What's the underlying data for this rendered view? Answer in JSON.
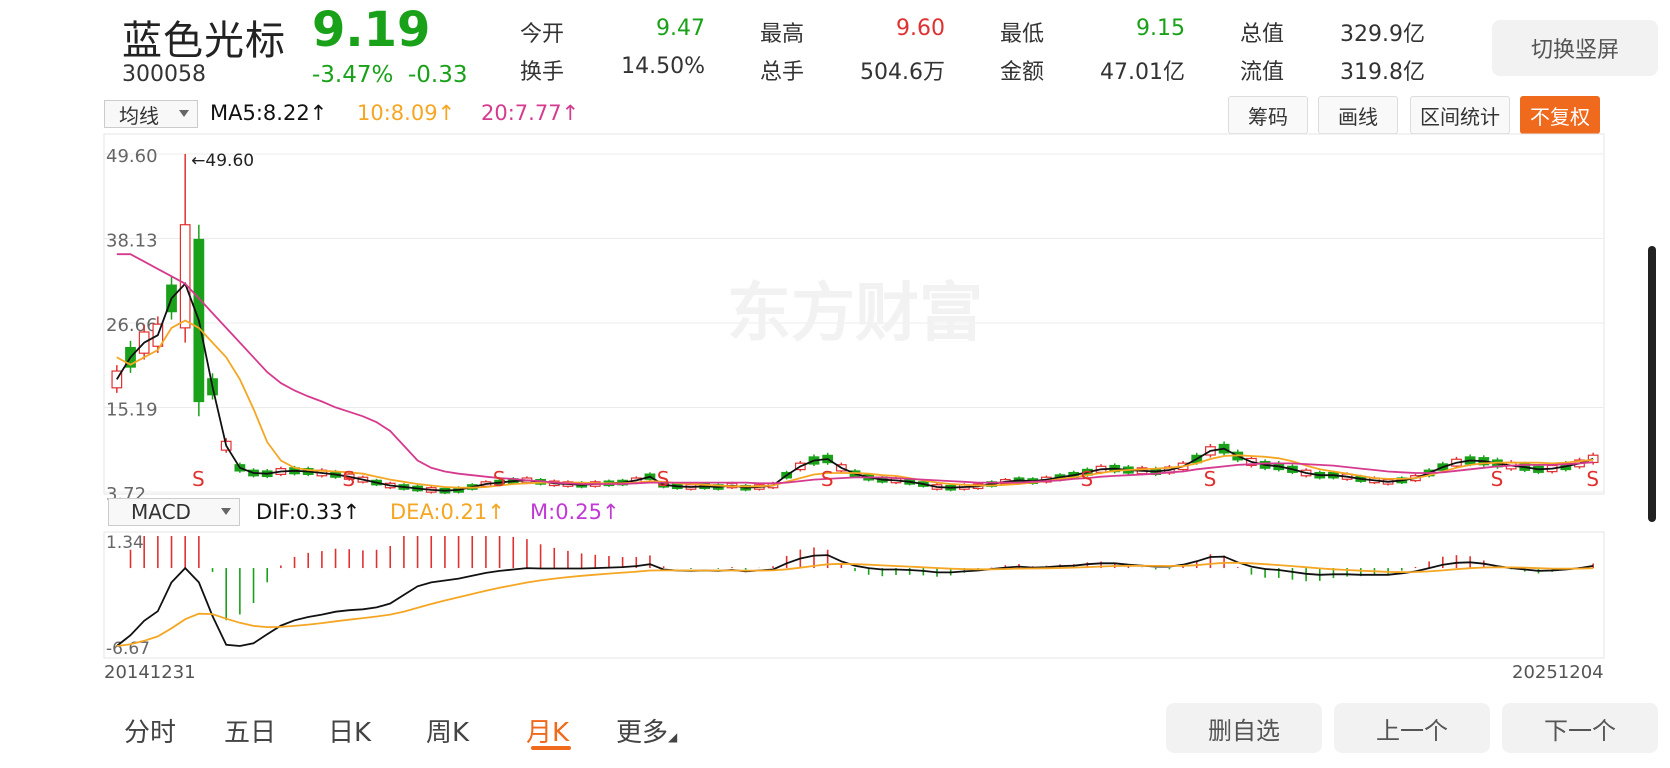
{
  "header": {
    "name": "蓝色光标",
    "code": "300058",
    "price": "9.19",
    "change_pct": "-3.47%",
    "change_amt": "-0.33",
    "stats": [
      {
        "label": "今开",
        "value": "9.47",
        "color": "green"
      },
      {
        "label": "最高",
        "value": "9.60",
        "color": "red"
      },
      {
        "label": "最低",
        "value": "9.15",
        "color": "green"
      },
      {
        "label": "总值",
        "value": "329.9亿",
        "color": "dark"
      },
      {
        "label": "换手",
        "value": "14.50%",
        "color": "dark"
      },
      {
        "label": "总手",
        "value": "504.6万",
        "color": "dark"
      },
      {
        "label": "金额",
        "value": "47.01亿",
        "color": "dark"
      },
      {
        "label": "流值",
        "value": "319.8亿",
        "color": "dark"
      }
    ],
    "switch_label": "切换竖屏"
  },
  "ma_bar": {
    "select": "均线",
    "ma5": "MA5:8.22↑",
    "ma10": "10:8.09↑",
    "ma20": "20:7.77↑",
    "colors": {
      "ma5": "#111111",
      "ma10": "#f5a623",
      "ma20": "#d63a8f"
    }
  },
  "tools": [
    {
      "label": "筹码",
      "active": false
    },
    {
      "label": "画线",
      "active": false
    },
    {
      "label": "区间统计",
      "active": false
    },
    {
      "label": "不复权",
      "active": true
    }
  ],
  "kline": {
    "y_ticks": [
      "49.60",
      "38.13",
      "26.66",
      "15.19",
      "3.72"
    ],
    "y_values": [
      49.6,
      38.13,
      26.66,
      15.19,
      3.72
    ],
    "max_annotation": "←49.60",
    "watermark": "东方财富",
    "markers": [
      "S",
      "S",
      "S",
      "S",
      "S",
      "S",
      "S",
      "S",
      "S"
    ]
  },
  "macd_bar": {
    "select": "MACD",
    "dif": "DIF:0.33↑",
    "dea": "DEA:0.21↑",
    "m": "M:0.25↑",
    "colors": {
      "dif": "#111111",
      "dea": "#f5a623",
      "m": "#c23ad6"
    },
    "y_ticks": [
      "1.34",
      "-6.67"
    ]
  },
  "dates": {
    "start": "20141231",
    "end": "20251204"
  },
  "bottom_tabs": [
    {
      "label": "分时",
      "active": false
    },
    {
      "label": "五日",
      "active": false
    },
    {
      "label": "日K",
      "active": false
    },
    {
      "label": "周K",
      "active": false
    },
    {
      "label": "月K",
      "active": true
    },
    {
      "label": "更多",
      "active": false
    }
  ],
  "bottom_buttons": [
    "删自选",
    "上一个",
    "下一个"
  ],
  "chart_data": {
    "type": "candlestick",
    "series": [
      {
        "name": "MA5",
        "values": [
          19,
          22,
          24,
          25,
          30,
          32,
          27,
          18,
          10,
          7,
          6.3,
          6.2,
          6.5,
          6.6,
          6.5,
          6.3,
          6.1,
          5.8,
          5.4,
          5.0,
          4.6,
          4.4,
          4.2,
          4.0,
          3.9,
          4.0,
          4.4,
          4.8,
          5.0,
          5.2,
          5.3,
          5.1,
          4.9,
          4.8,
          4.7,
          4.8,
          4.9,
          5.0,
          5.3,
          5.8,
          4.7,
          4.5,
          4.4,
          4.5,
          4.4,
          4.6,
          4.3,
          4.4,
          4.6,
          6.0,
          7.2,
          8.0,
          8.2,
          7.0,
          6.2,
          5.7,
          5.4,
          5.3,
          5.1,
          4.8,
          4.4,
          4.3,
          4.4,
          4.5,
          4.8,
          5.1,
          5.3,
          5.2,
          5.4,
          5.7,
          6.0,
          6.4,
          6.8,
          6.9,
          6.7,
          6.6,
          6.5,
          6.7,
          7.2,
          8.2,
          9.3,
          9.6,
          8.6,
          7.8,
          7.4,
          7.2,
          6.8,
          6.3,
          6.0,
          6.0,
          5.8,
          5.5,
          5.3,
          5.1,
          5.3,
          5.6,
          6.3,
          7.1,
          7.7,
          8.0,
          7.9,
          7.6,
          7.3,
          7.1,
          6.8,
          6.9,
          7.2,
          7.6,
          8.22
        ]
      },
      {
        "name": "10",
        "values": [
          22,
          21,
          22,
          23,
          26,
          27,
          26,
          24,
          22,
          19,
          15,
          10.5,
          8.0,
          7.0,
          6.7,
          6.6,
          6.5,
          6.4,
          6.2,
          5.8,
          5.4,
          5.1,
          4.8,
          4.6,
          4.4,
          4.3,
          4.3,
          4.4,
          4.6,
          4.8,
          4.9,
          5.0,
          5.0,
          5.0,
          5.0,
          4.9,
          4.9,
          4.9,
          5.0,
          5.2,
          5.1,
          4.9,
          4.8,
          4.7,
          4.6,
          4.5,
          4.5,
          4.5,
          4.6,
          5.1,
          5.6,
          6.1,
          6.3,
          6.3,
          6.3,
          6.2,
          6.0,
          5.9,
          5.6,
          5.3,
          5.0,
          4.8,
          4.7,
          4.6,
          4.6,
          4.7,
          4.8,
          5.0,
          5.2,
          5.5,
          5.7,
          6.0,
          6.3,
          6.6,
          6.7,
          6.8,
          6.9,
          7.0,
          7.2,
          7.6,
          8.2,
          8.6,
          8.7,
          8.6,
          8.5,
          8.3,
          7.9,
          7.3,
          6.8,
          6.5,
          6.2,
          5.9,
          5.6,
          5.5,
          5.5,
          5.6,
          6.0,
          6.5,
          7.0,
          7.4,
          7.6,
          7.7,
          7.7,
          7.7,
          7.7,
          7.6,
          7.7,
          7.9,
          8.09
        ]
      },
      {
        "name": "20",
        "values": [
          36,
          36,
          35,
          34,
          33,
          32,
          30,
          28,
          26,
          24,
          22,
          20,
          18.5,
          17.5,
          16.7,
          16.0,
          15.2,
          14.6,
          14.0,
          13.2,
          12.0,
          10.0,
          8.0,
          7.0,
          6.5,
          6.2,
          6.0,
          5.8,
          5.6,
          5.5,
          5.3,
          5.2,
          5.0,
          4.9,
          4.8,
          4.8,
          4.8,
          4.8,
          4.9,
          5.0,
          5.0,
          5.0,
          5.0,
          5.0,
          5.0,
          5.0,
          5.0,
          4.9,
          4.9,
          5.0,
          5.2,
          5.4,
          5.5,
          5.6,
          5.7,
          5.7,
          5.7,
          5.6,
          5.5,
          5.4,
          5.3,
          5.2,
          5.1,
          5.0,
          5.0,
          5.0,
          5.0,
          5.1,
          5.2,
          5.3,
          5.5,
          5.6,
          5.8,
          5.9,
          6.0,
          6.1,
          6.2,
          6.4,
          6.5,
          6.8,
          7.0,
          7.2,
          7.4,
          7.5,
          7.6,
          7.6,
          7.6,
          7.5,
          7.4,
          7.3,
          7.1,
          6.9,
          6.7,
          6.5,
          6.4,
          6.3,
          6.3,
          6.4,
          6.6,
          6.8,
          7.0,
          7.2,
          7.3,
          7.4,
          7.4,
          7.4,
          7.5,
          7.6,
          7.77
        ]
      }
    ],
    "ylim": [
      3.72,
      49.6
    ],
    "x_start": "20141231",
    "x_end": "20251204"
  }
}
